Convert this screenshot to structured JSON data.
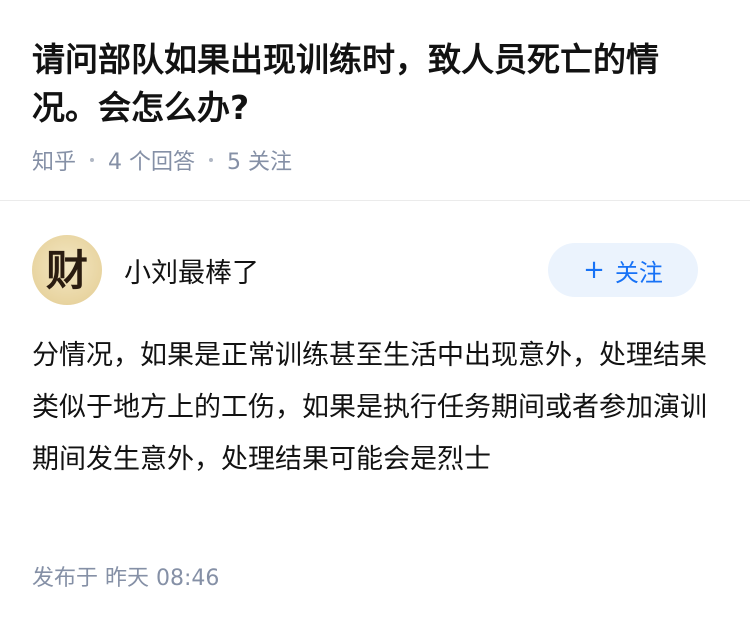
{
  "question": {
    "title": "请问部队如果出现训练时，致人员死亡的情况。会怎么办?",
    "source": "知乎",
    "answers_count": "4 个回答",
    "follows_count": "5 关注"
  },
  "answer": {
    "author_name": "小刘最棒了",
    "avatar_glyph": "财",
    "follow_plus": "+",
    "follow_label": "关注",
    "content": "分情况，如果是正常训练甚至生活中出现意外，处理结果类似于地方上的工伤，如果是执行任务期间或者参加演训期间发生意外，处理结果可能会是烈士",
    "posted_label": "发布于",
    "posted_time": "昨天 08:46"
  },
  "colors": {
    "accent": "#1772f6",
    "follow_bg": "#ebf3fd",
    "meta_gray": "#8590a6",
    "text": "#121212",
    "avatar_bg": "#e8d4a0"
  },
  "icons": {
    "avatar": "calligraphy-avatar-icon",
    "follow": "plus-icon"
  }
}
